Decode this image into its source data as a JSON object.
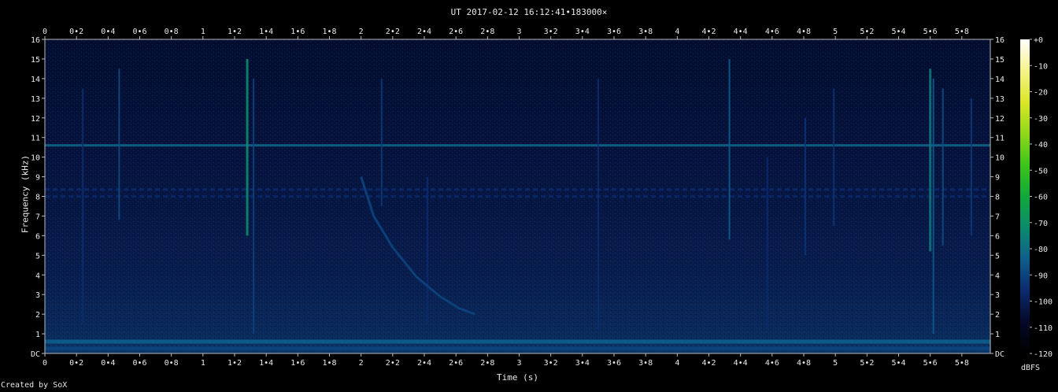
{
  "chart_data": {
    "type": "heatmap",
    "title": "UT 2017-02-12 16:12:41•183000×",
    "xlabel": "Time (s)",
    "ylabel": "Frequency (kHz)",
    "xlim": [
      0,
      5.98
    ],
    "ylim": [
      0,
      16
    ],
    "x_ticks": [
      "0",
      "0•2",
      "0•4",
      "0•6",
      "0•8",
      "1",
      "1•2",
      "1•4",
      "1•6",
      "1•8",
      "2",
      "2•2",
      "2•4",
      "2•6",
      "2•8",
      "3",
      "3•2",
      "3•4",
      "3•6",
      "3•8",
      "4",
      "4•2",
      "4•4",
      "4•6",
      "4•8",
      "5",
      "5•2",
      "5•4",
      "5•6",
      "5•8"
    ],
    "y_ticks": [
      "DC",
      "1",
      "2",
      "3",
      "4",
      "5",
      "6",
      "7",
      "8",
      "9",
      "10",
      "11",
      "12",
      "13",
      "14",
      "15",
      "16"
    ],
    "colorbar": {
      "label": "dBFS",
      "ticks": [
        "+0",
        "-10",
        "-20",
        "-30",
        "-40",
        "-50",
        "-60",
        "-70",
        "-80",
        "-90",
        "-100",
        "-110",
        "-120"
      ],
      "range": [
        -120,
        0
      ]
    },
    "features": {
      "noise_floor_dbfs": -100,
      "horizontal_tones": [
        {
          "freq_khz": 10.6,
          "level_dbfs": -82
        },
        {
          "freq_khz": 8.35,
          "level_dbfs": -96,
          "dashed": true
        },
        {
          "freq_khz": 8.0,
          "level_dbfs": -97,
          "dashed": true
        },
        {
          "freq_khz": 0.6,
          "level_dbfs": -84
        },
        {
          "freq_khz": 0.25,
          "level_dbfs": -90
        }
      ],
      "vertical_impulses": [
        {
          "time_s": 0.24,
          "f_low_khz": 1.5,
          "f_high_khz": 13.5,
          "level_dbfs": -95
        },
        {
          "time_s": 0.47,
          "f_low_khz": 6.8,
          "f_high_khz": 14.5,
          "level_dbfs": -88
        },
        {
          "time_s": 1.28,
          "f_low_khz": 6.0,
          "f_high_khz": 15.0,
          "level_dbfs": -72
        },
        {
          "time_s": 1.32,
          "f_low_khz": 1.0,
          "f_high_khz": 14.0,
          "level_dbfs": -90
        },
        {
          "time_s": 2.13,
          "f_low_khz": 7.5,
          "f_high_khz": 14.0,
          "level_dbfs": -92
        },
        {
          "time_s": 2.42,
          "f_low_khz": 1.5,
          "f_high_khz": 9.0,
          "level_dbfs": -96
        },
        {
          "time_s": 3.5,
          "f_low_khz": 1.2,
          "f_high_khz": 14.0,
          "level_dbfs": -95
        },
        {
          "time_s": 4.33,
          "f_low_khz": 5.8,
          "f_high_khz": 15.0,
          "level_dbfs": -85
        },
        {
          "time_s": 4.57,
          "f_low_khz": 1.2,
          "f_high_khz": 10.0,
          "level_dbfs": -96
        },
        {
          "time_s": 4.81,
          "f_low_khz": 5.0,
          "f_high_khz": 12.0,
          "level_dbfs": -94
        },
        {
          "time_s": 4.99,
          "f_low_khz": 6.5,
          "f_high_khz": 13.5,
          "level_dbfs": -94
        },
        {
          "time_s": 5.6,
          "f_low_khz": 5.2,
          "f_high_khz": 14.5,
          "level_dbfs": -78
        },
        {
          "time_s": 5.62,
          "f_low_khz": 1.0,
          "f_high_khz": 14.0,
          "level_dbfs": -85
        },
        {
          "time_s": 5.68,
          "f_low_khz": 5.5,
          "f_high_khz": 13.5,
          "level_dbfs": -88
        },
        {
          "time_s": 5.86,
          "f_low_khz": 6.0,
          "f_high_khz": 13.0,
          "level_dbfs": -92
        }
      ],
      "sweeps": [
        {
          "points": [
            [
              2.0,
              9.0
            ],
            [
              2.08,
              7.0
            ],
            [
              2.2,
              5.4
            ],
            [
              2.35,
              3.9
            ],
            [
              2.5,
              2.9
            ],
            [
              2.62,
              2.3
            ],
            [
              2.72,
              2.0
            ]
          ],
          "level_dbfs": -90
        }
      ]
    }
  }
}
